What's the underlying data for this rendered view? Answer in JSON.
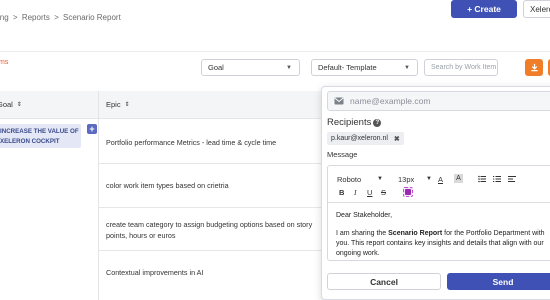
{
  "header": {
    "breadcrumb": [
      "ing",
      "Reports",
      "Scenario Report"
    ],
    "separator": ">",
    "create_label": "+ Create",
    "workspace_label": "Xeleron"
  },
  "toolbar": {
    "ms_label": "ms",
    "goal_select": "Goal",
    "template_select": "Default- Template",
    "search_placeholder": "Search by Work Item"
  },
  "table": {
    "columns": [
      "Goal",
      "Epic"
    ],
    "goal_chip": "INCREASE THE VALUE OF XELERON COCKPIT",
    "rows": [
      "Portfolio performance Metrics - lead time & cycle time",
      "color work item types based on crietria",
      "create team category to assign budgeting options based on story points, hours or euros",
      "Contextual improvements in AI"
    ]
  },
  "email_popup": {
    "email_placeholder": "name@example.com",
    "recipients_label": "Recipients",
    "recipient_chip": "p.kaur@xeleron.nl",
    "message_label": "Message",
    "font_family": "Roboto",
    "font_size": "13px",
    "greeting": "Dear Stakeholder,",
    "body_prefix": "I am sharing the ",
    "body_bold": "Scenario Report",
    "body_suffix": " for the Portfolio Department with you. This report contains key insights and details that align with our ongoing work.",
    "cancel_label": "Cancel",
    "send_label": "Send"
  },
  "colors": {
    "primary": "#3f51b5",
    "accent_orange": "#f07d28"
  }
}
